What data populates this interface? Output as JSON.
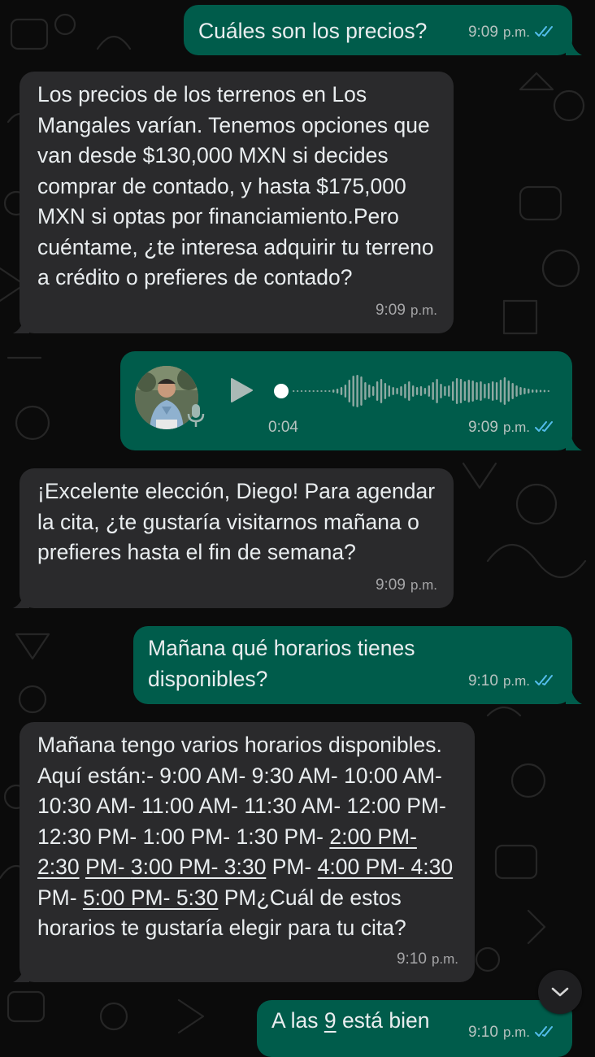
{
  "messages": [
    {
      "id": "m1",
      "text": "Cuáles son los precios?",
      "time": "9:09",
      "ampm": "p.m."
    },
    {
      "id": "m2",
      "text": "Los precios de los terrenos en Los Mangales varían. Tenemos opciones que van desde $130,000 MXN si decides comprar de contado, y hasta $175,000 MXN si optas por financiamiento.Pero cuéntame, ¿te interesa adquirir tu terreno a crédito o prefieres de contado?",
      "time": "9:09",
      "ampm": "p.m."
    },
    {
      "id": "m3",
      "type": "voice",
      "duration": "0:04",
      "time": "9:09",
      "ampm": "p.m.",
      "progress": 0
    },
    {
      "id": "m4",
      "text": "¡Excelente elección, Diego! Para agendar la cita, ¿te gustaría visitarnos mañana o prefieres hasta el fin de semana?",
      "time": "9:09",
      "ampm": "p.m."
    },
    {
      "id": "m5",
      "text": "Mañana qué horarios tienes disponibles?",
      "time": "9:10",
      "ampm": "p.m."
    },
    {
      "id": "m6",
      "parts": [
        "Mañana tengo varios horarios disponibles. Aquí están:- 9:00 AM- 9:30 AM- 10:00 AM- 10:30 AM- 11:00 AM- 11:30 AM- 12:00 PM- 12:30 PM- 1:00 PM- 1:30 PM- ",
        "2:00 PM- 2:30",
        "PM- ",
        "3:00 PM- 3:30",
        " PM- ",
        "4:00 PM- 4:30",
        " PM- ",
        "5:00 PM- 5:30",
        " PM¿Cuál de estos horarios te gustaría elegir para tu cita?"
      ],
      "time": "9:10",
      "ampm": "p.m."
    },
    {
      "id": "m7",
      "parts": [
        "A las ",
        "9",
        " está bien"
      ],
      "time": "9:10",
      "ampm": "p.m."
    }
  ],
  "colors": {
    "outgoing": "#005c4b",
    "incoming": "#2a2a2c",
    "read_ticks": "#53bdeb",
    "background": "#0b0b0b"
  }
}
